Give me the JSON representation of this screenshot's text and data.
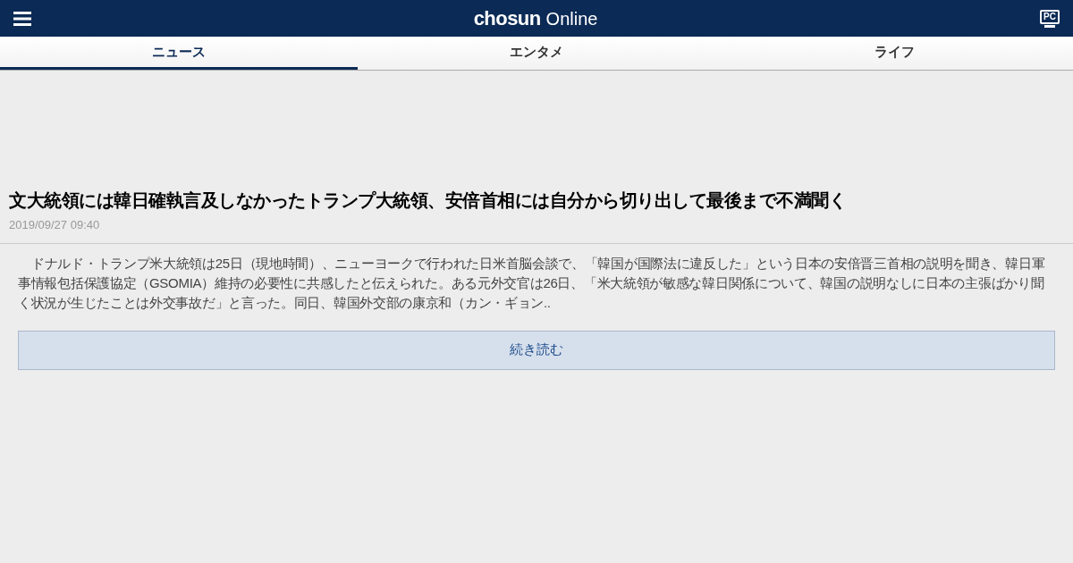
{
  "header": {
    "logo_main": "chosun",
    "logo_sub": "Online",
    "pc_label": "PC"
  },
  "tabs": [
    {
      "label": "ニュース",
      "selected": true
    },
    {
      "label": "エンタメ",
      "selected": false
    },
    {
      "label": "ライフ",
      "selected": false
    }
  ],
  "article": {
    "title": "文大統領には韓日確執言及しなかったトランプ大統領、安倍首相には自分から切り出して最後まで不満聞く",
    "date": "2019/09/27 09:40",
    "body": "ドナルド・トランプ米大統領は25日（現地時間）、ニューヨークで行われた日米首脳会談で、「韓国が国際法に違反した」という日本の安倍晋三首相の説明を聞き、韓日軍事情報包括保護協定（GSOMIA）維持の必要性に共感したと伝えられた。ある元外交官は26日、「米大統領が敏感な韓日関係について、韓国の説明なしに日本の主張ばかり聞く状況が生じたことは外交事故だ」と言った。同日、韓国外交部の康京和（カン・ギョン..",
    "more_button": "続き読む"
  }
}
